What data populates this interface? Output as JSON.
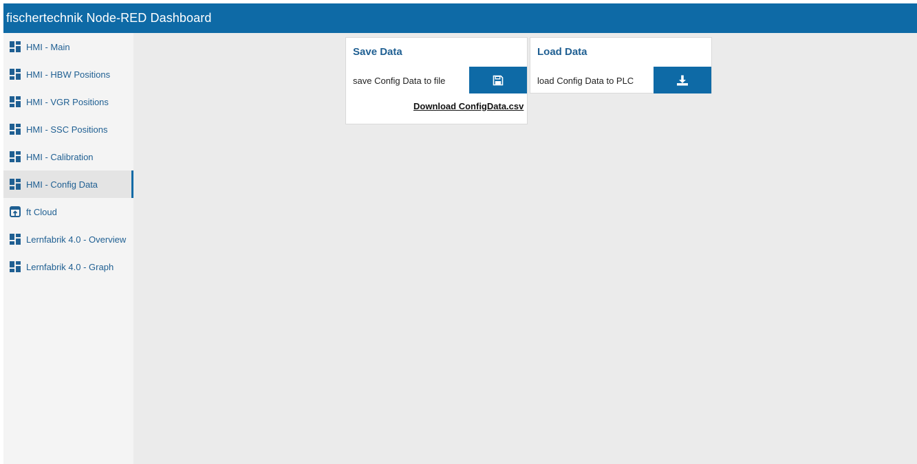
{
  "toolbar": {
    "title": "fischertechnik Node-RED Dashboard",
    "color": "#0e6aa6"
  },
  "sidebar": {
    "items": [
      {
        "label": "HMI - Main",
        "icon": "dashboard-icon",
        "active": false
      },
      {
        "label": "HMI - HBW Positions",
        "icon": "dashboard-icon",
        "active": false
      },
      {
        "label": "HMI - VGR Positions",
        "icon": "dashboard-icon",
        "active": false
      },
      {
        "label": "HMI - SSC Positions",
        "icon": "dashboard-icon",
        "active": false
      },
      {
        "label": "HMI - Calibration",
        "icon": "dashboard-icon",
        "active": false
      },
      {
        "label": "HMI - Config Data",
        "icon": "dashboard-icon",
        "active": true
      },
      {
        "label": "ft Cloud",
        "icon": "external-link-icon",
        "active": false
      },
      {
        "label": "Lernfabrik 4.0 - Overview",
        "icon": "dashboard-icon",
        "active": false
      },
      {
        "label": "Lernfabrik 4.0 - Graph",
        "icon": "dashboard-icon",
        "active": false
      }
    ]
  },
  "save_card": {
    "title": "Save Data",
    "label": "save Config Data to file",
    "button_icon": "save-icon",
    "link_text": "Download ConfigData.csv"
  },
  "load_card": {
    "title": "Load Data",
    "label": "load Config Data to PLC",
    "button_icon": "download-icon"
  },
  "colors": {
    "accent": "#0e6aa6",
    "nav_text": "#1f5f92",
    "background": "#ebebeb"
  }
}
